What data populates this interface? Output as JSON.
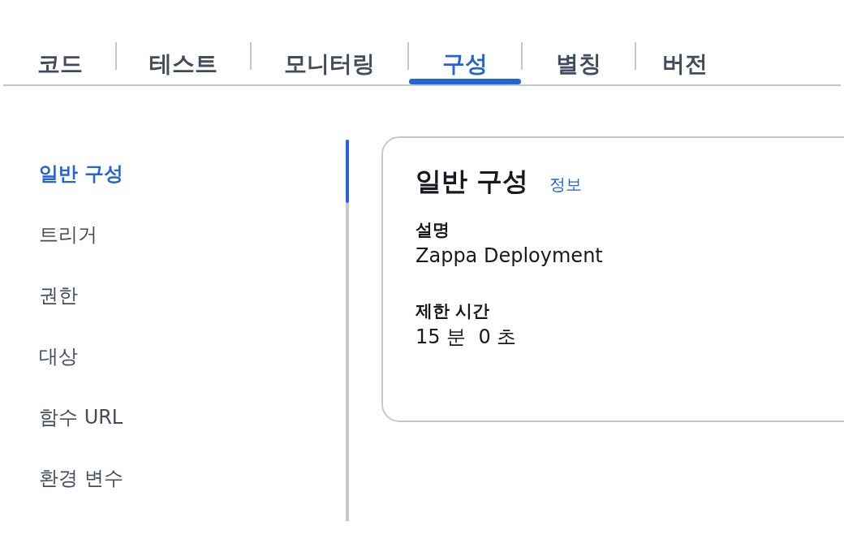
{
  "tabs": [
    {
      "label": "코드",
      "selected": false
    },
    {
      "label": "테스트",
      "selected": false
    },
    {
      "label": "모니터링",
      "selected": false
    },
    {
      "label": "구성",
      "selected": true
    },
    {
      "label": "별칭",
      "selected": false
    },
    {
      "label": "버전",
      "selected": false
    }
  ],
  "sidebar": {
    "items": [
      {
        "label": "일반 구성",
        "selected": true
      },
      {
        "label": "트리거",
        "selected": false
      },
      {
        "label": "권한",
        "selected": false
      },
      {
        "label": "대상",
        "selected": false
      },
      {
        "label": "함수 URL",
        "selected": false
      },
      {
        "label": "환경 변수",
        "selected": false
      }
    ]
  },
  "card": {
    "title": "일반 구성",
    "info_link": "정보",
    "fields": [
      {
        "label": "설명",
        "value": "Zappa Deployment"
      },
      {
        "label": "제한 시간",
        "value": "15 분  0 초"
      }
    ]
  }
}
